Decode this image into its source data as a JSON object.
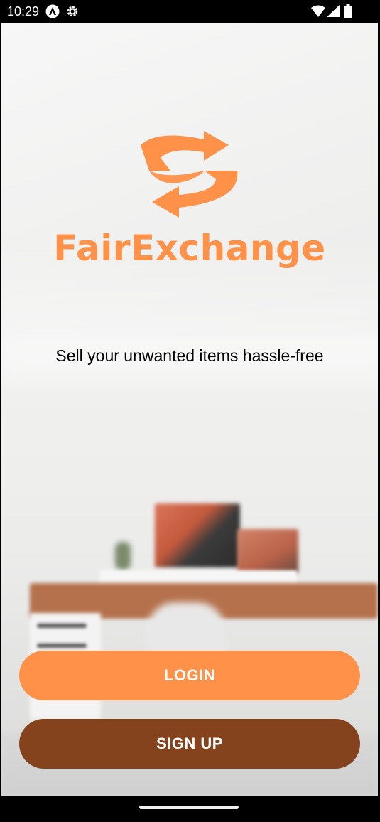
{
  "status_bar": {
    "time": "10:29",
    "icons": [
      "app-notification-icon",
      "settings-gear-icon",
      "wifi-icon",
      "signal-icon",
      "battery-icon"
    ]
  },
  "branding": {
    "logo_icon": "exchange-arrows-icon",
    "app_name": "FairExchange",
    "accent_color": "#ff9149"
  },
  "tagline": "Sell your unwanted items hassle-free",
  "actions": {
    "login_label": "LOGIN",
    "login_color": "#ff9149",
    "signup_label": "SIGN UP",
    "signup_color": "#84421d"
  },
  "nav_bar": {
    "home_indicator": "home-gesture-pill"
  }
}
